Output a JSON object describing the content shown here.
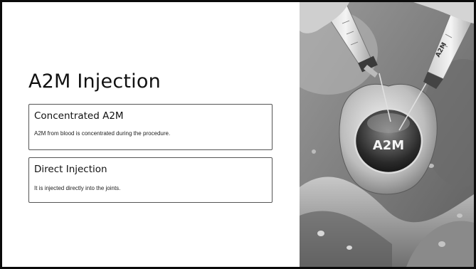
{
  "slide": {
    "title": "A2M Injection",
    "cards": [
      {
        "title": "Concentrated A2M",
        "description": "A2M from blood is concentrated during the procedure."
      },
      {
        "title": "Direct Injection",
        "description": "It is injected directly into the joints."
      }
    ]
  },
  "image": {
    "joint_label": "A2M",
    "syringe_label": "A2M"
  },
  "colors": {
    "background": "#ffffff",
    "frame": "#0b0b0b",
    "text": "#111111",
    "card_border": "#555555"
  }
}
